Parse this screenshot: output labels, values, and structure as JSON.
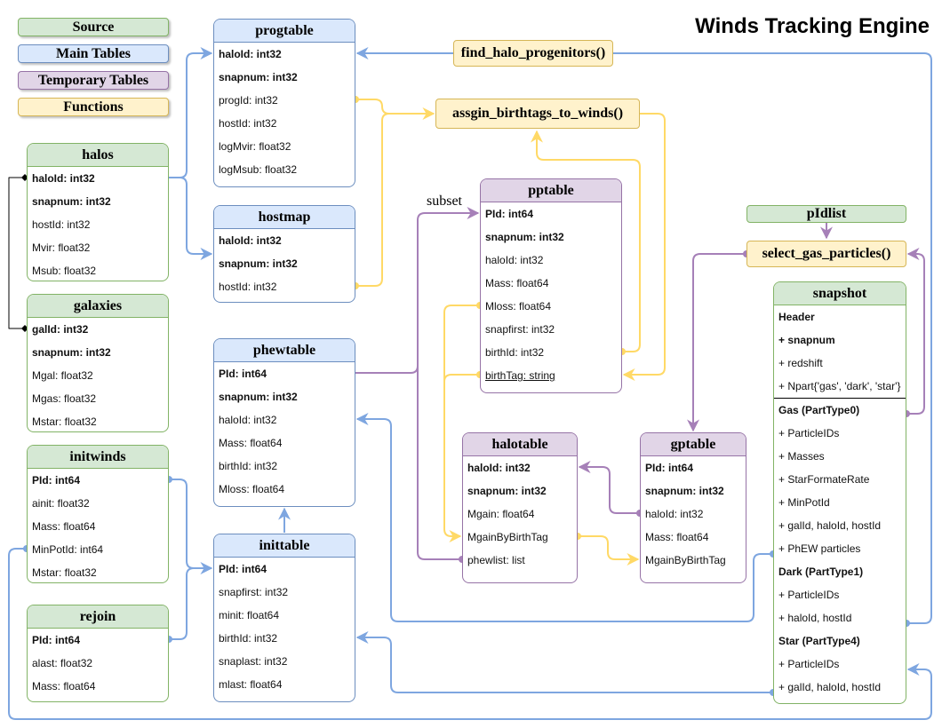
{
  "title": "Winds Tracking Engine",
  "legend": [
    {
      "label": "Source",
      "kind": "source"
    },
    {
      "label": "Main Tables",
      "kind": "main"
    },
    {
      "label": "Temporary Tables",
      "kind": "temporary"
    },
    {
      "label": "Functions",
      "kind": "function"
    }
  ],
  "colors": {
    "source_fill": "#d5e8d4",
    "source_stroke": "#82b366",
    "main_fill": "#dae8fc",
    "main_stroke": "#6c8ebf",
    "temp_fill": "#e1d5e7",
    "temp_stroke": "#9673a6",
    "func_fill": "#fff2cc",
    "func_stroke": "#d6b656",
    "blue_edge": "#7ea6e0",
    "yellow_edge": "#ffd966",
    "purple_edge": "#a680b8",
    "black_edge": "#000000"
  },
  "functions": {
    "find_halo_progenitors": "find_halo_progenitors()",
    "assign_birthtags": "assgin_birthtags_to_winds()",
    "select_gas_particles": "select_gas_particles()"
  },
  "sources_plain": {
    "pidlist": "pIdlist"
  },
  "edge_labels": {
    "subset": "subset"
  },
  "tables": {
    "halos": {
      "title": "halos",
      "fields": [
        {
          "text": "haloId: int32",
          "bold": true
        },
        {
          "text": "snapnum: int32",
          "bold": true
        },
        {
          "text": "hostId: int32"
        },
        {
          "text": "Mvir: float32"
        },
        {
          "text": "Msub: float32"
        }
      ]
    },
    "galaxies": {
      "title": "galaxies",
      "fields": [
        {
          "text": "galId: int32",
          "bold": true
        },
        {
          "text": "snapnum: int32",
          "bold": true
        },
        {
          "text": "Mgal: float32"
        },
        {
          "text": "Mgas: float32"
        },
        {
          "text": "Mstar: float32"
        }
      ]
    },
    "initwinds": {
      "title": "initwinds",
      "fields": [
        {
          "text": "PId: int64",
          "bold": true
        },
        {
          "text": "ainit: float32"
        },
        {
          "text": "Mass: float64"
        },
        {
          "text": "MinPotId: int64"
        },
        {
          "text": "Mstar: float32"
        }
      ]
    },
    "rejoin": {
      "title": "rejoin",
      "fields": [
        {
          "text": "PId: int64",
          "bold": true
        },
        {
          "text": "alast: float32"
        },
        {
          "text": "Mass: float64"
        }
      ]
    },
    "progtable": {
      "title": "progtable",
      "fields": [
        {
          "text": "haloId: int32",
          "bold": true
        },
        {
          "text": "snapnum: int32",
          "bold": true
        },
        {
          "text": "progId: int32"
        },
        {
          "text": "hostId: int32"
        },
        {
          "text": "logMvir: float32"
        },
        {
          "text": "logMsub: float32"
        }
      ]
    },
    "hostmap": {
      "title": "hostmap",
      "fields": [
        {
          "text": "haloId: int32",
          "bold": true
        },
        {
          "text": "snapnum: int32",
          "bold": true
        },
        {
          "text": "hostId: int32"
        }
      ]
    },
    "phewtable": {
      "title": "phewtable",
      "fields": [
        {
          "text": "PId: int64",
          "bold": true
        },
        {
          "text": "snapnum: int32",
          "bold": true
        },
        {
          "text": "haloId: int32"
        },
        {
          "text": "Mass: float64"
        },
        {
          "text": "birthId: int32"
        },
        {
          "text": "Mloss: float64"
        }
      ]
    },
    "inittable": {
      "title": "inittable",
      "fields": [
        {
          "text": "PId: int64",
          "bold": true
        },
        {
          "text": "snapfirst: int32"
        },
        {
          "text": "minit: float64"
        },
        {
          "text": "birthId: int32"
        },
        {
          "text": "snaplast: int32"
        },
        {
          "text": "mlast: float64"
        }
      ]
    },
    "pptable": {
      "title": "pptable",
      "fields": [
        {
          "text": "PId: int64",
          "bold": true
        },
        {
          "text": "snapnum: int32",
          "bold": true
        },
        {
          "text": "haloId: int32"
        },
        {
          "text": "Mass: float64"
        },
        {
          "text": "Mloss: float64"
        },
        {
          "text": "snapfirst: int32"
        },
        {
          "text": "birthId: int32"
        },
        {
          "text": "birthTag: string",
          "underline": true
        }
      ]
    },
    "halotable": {
      "title": "halotable",
      "fields": [
        {
          "text": "haloId: int32",
          "bold": true
        },
        {
          "text": "snapnum: int32",
          "bold": true
        },
        {
          "text": "Mgain: float64"
        },
        {
          "text": "MgainByBirthTag"
        },
        {
          "text": "phewlist: list"
        }
      ]
    },
    "gptable": {
      "title": "gptable",
      "fields": [
        {
          "text": "PId: int64",
          "bold": true
        },
        {
          "text": "snapnum: int32",
          "bold": true
        },
        {
          "text": "haloId: int32"
        },
        {
          "text": "Mass: float64"
        },
        {
          "text": "MgainByBirthTag"
        }
      ]
    },
    "snapshot": {
      "title": "snapshot",
      "fields": [
        {
          "text": "Header",
          "bold": true
        },
        {
          "text": "+ snapnum",
          "bold": true
        },
        {
          "text": "+ redshift"
        },
        {
          "text": "+ Npart{'gas', 'dark', 'star'}"
        },
        {
          "separator": true
        },
        {
          "text": "Gas (PartType0)",
          "bold": true
        },
        {
          "text": "+ ParticleIDs"
        },
        {
          "text": "+ Masses"
        },
        {
          "text": "+ StarFormateRate"
        },
        {
          "text": "+ MinPotId"
        },
        {
          "text": "+ galId, haloId, hostId"
        },
        {
          "text": "+ PhEW particles"
        },
        {
          "text": "Dark (PartType1)",
          "bold": true
        },
        {
          "text": "+ ParticleIDs"
        },
        {
          "text": "+ haloId, hostId"
        },
        {
          "text": "Star (PartType4)",
          "bold": true
        },
        {
          "text": "+ ParticleIDs"
        },
        {
          "text": "+ galId, haloId, hostId"
        }
      ]
    }
  }
}
